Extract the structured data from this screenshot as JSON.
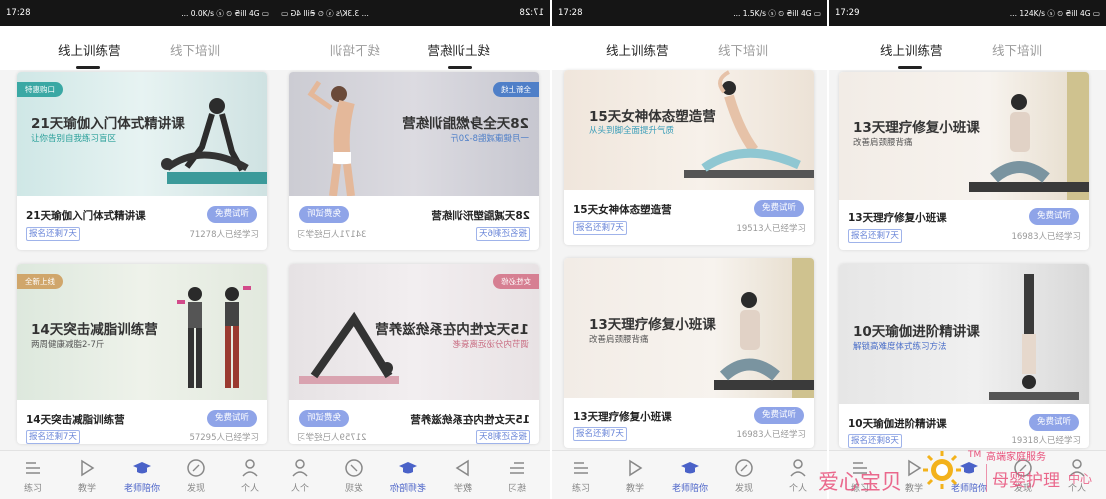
{
  "tabs": {
    "online": "线上训练营",
    "offline": "线下培训"
  },
  "status_bars": [
    {
      "time": "17:28",
      "right": "... 0.0K/s ⓢ ⏲ ₴ill 4G ▭"
    },
    {
      "time": "17:28",
      "right": "... 3.3K/s ⓢ ⏲ ₴ill 4G ▭"
    },
    {
      "time": "17:28",
      "right": "... 1.5K/s ⓢ ⏲ ₴ill 4G ▭"
    },
    {
      "time": "17:29",
      "right": "... 124K/s ⓢ ⏲ ₴ill 4G ▭"
    }
  ],
  "common": {
    "trial": "免费试听"
  },
  "nav": {
    "items": [
      {
        "label": "练习",
        "icon": "practice-icon"
      },
      {
        "label": "教学",
        "icon": "play-icon"
      },
      {
        "label": "老师陪你",
        "icon": "graduation-cap-icon"
      },
      {
        "label": "发现",
        "icon": "compass-icon"
      },
      {
        "label": "个人",
        "icon": "person-icon"
      }
    ]
  },
  "screens": [
    {
      "cards": [
        {
          "tag": "特惠购口",
          "img_title": "21天瑜伽入门体式精讲课",
          "img_sub": "让你告别自我练习盲区",
          "title": "21天瑜伽入门体式精讲课",
          "remain": "报名还剩7天",
          "learned": "71278人已经学习"
        },
        {
          "tag": "全新上线",
          "img_title": "14天突击减脂训练营",
          "img_sub": "两周健康减脂2-7斤",
          "title": "14天突击减脂训练营",
          "remain": "报名还剩7天",
          "learned": "57295人已经学习"
        }
      ]
    },
    {
      "cards": [
        {
          "tag": "全新上线",
          "img_title": "28天全身燃脂训练营",
          "img_sub": "一月健康减脂8-20斤",
          "title": "28天减脂塑形训练营",
          "remain": "报名还剩6天",
          "learned": "34171人已经学习"
        },
        {
          "tag": "女性必修",
          "img_title": "15天女性内在系统滋养营",
          "img_sub": "调节内分泌远离衰老",
          "title": "15天女性内在系统滋养营",
          "remain": "报名还剩8天",
          "learned": "21759人已经学习"
        }
      ]
    },
    {
      "cards": [
        {
          "img_title": "15天女神体态塑造营",
          "img_sub": "从头到脚全面提升气质",
          "title": "15天女神体态塑造营",
          "remain": "报名还剩7天",
          "learned": "19513人已经学习"
        },
        {
          "img_title": "13天理疗修复小班课",
          "img_sub": "改善肩颈腰背痛",
          "title": "13天理疗修复小班课",
          "remain": "报名还剩7天",
          "learned": "16983人已经学习"
        }
      ]
    },
    {
      "cards": [
        {
          "img_title": "13天理疗修复小班课",
          "img_sub": "改善肩颈腰背痛",
          "title": "13天理疗修复小班课",
          "remain": "报名还剩7天",
          "learned": "16983人已经学习"
        },
        {
          "img_title": "10天瑜伽进阶精讲课",
          "img_sub": "解锁高难度体式练习方法",
          "title": "10天瑜伽进阶精讲课",
          "remain": "报名还剩8天",
          "learned": "19318人已经学习"
        }
      ]
    }
  ],
  "watermark": {
    "text1": "爱心宝贝",
    "text2": "高端家庭服务",
    "text3": "母婴护理",
    "text4": "中心",
    "tm": "TM"
  },
  "colors": {
    "accent": "#4a62c8",
    "trial_button": "#8fa4e8",
    "status_bar": "#151515"
  }
}
